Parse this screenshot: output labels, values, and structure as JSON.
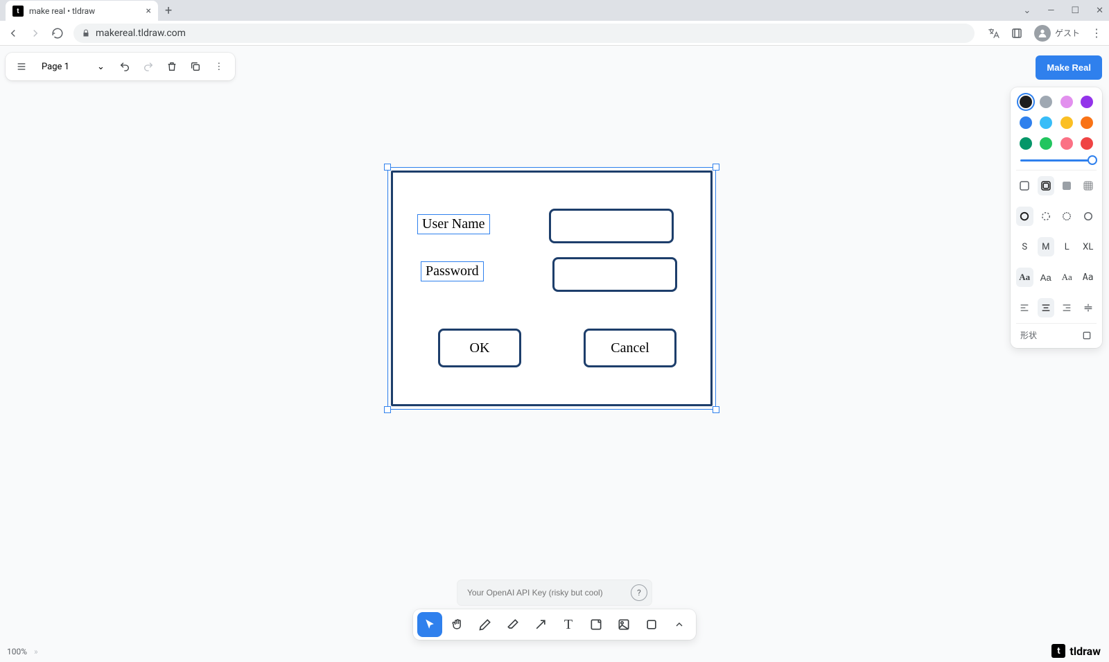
{
  "browser": {
    "tab_title": "make real • tldraw",
    "url": "makereal.tldraw.com",
    "profile_label": "ゲスト"
  },
  "top_toolbar": {
    "page_label": "Page 1"
  },
  "make_real_label": "Make Real",
  "style_panel": {
    "colors": [
      "#1d1d1d",
      "#9fa8b2",
      "#c77dff",
      "#9333ea",
      "#2f80ed",
      "#38bdf8",
      "#fbbf24",
      "#f97316",
      "#059669",
      "#22c55e",
      "#fb7185",
      "#ef4444"
    ],
    "size_labels": [
      "S",
      "M",
      "L",
      "XL"
    ],
    "font_labels": [
      "Aa",
      "Aa",
      "Aa",
      "Aa"
    ],
    "shape_section_label": "形状"
  },
  "mockup": {
    "username_label": "User Name",
    "password_label": "Password",
    "ok_label": "OK",
    "cancel_label": "Cancel"
  },
  "api": {
    "placeholder": "Your OpenAI API Key (risky but cool)"
  },
  "zoom": {
    "value": "100%"
  },
  "watermark": {
    "text": "tldraw"
  }
}
